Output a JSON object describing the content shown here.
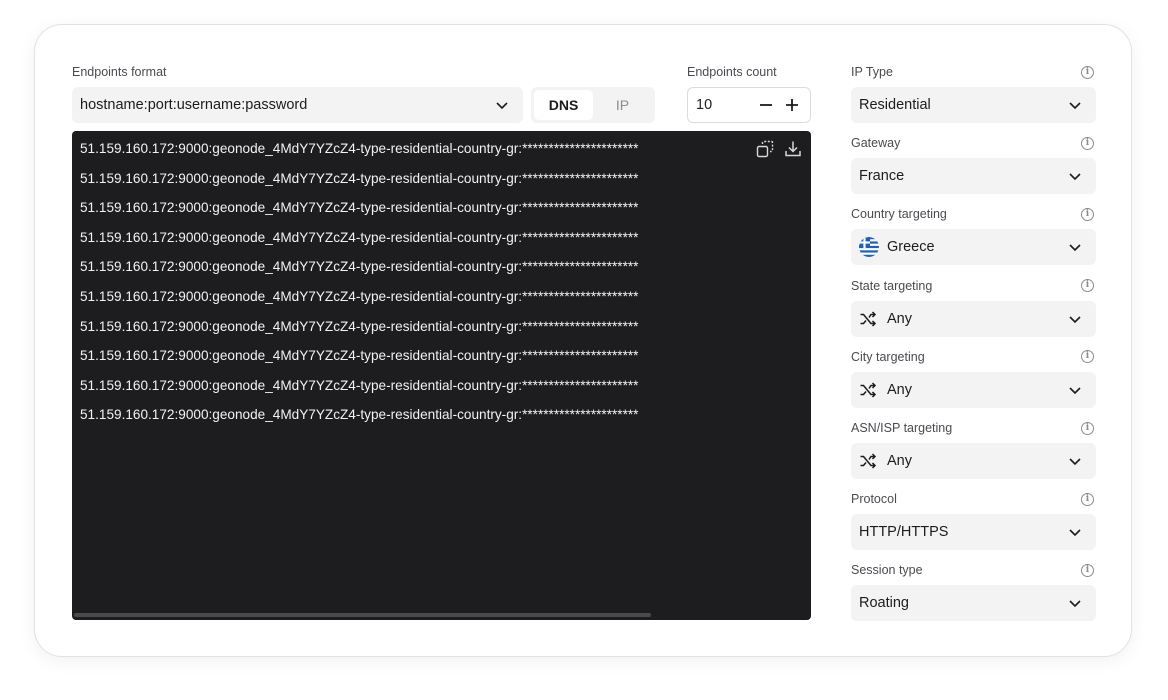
{
  "left": {
    "endpoints_format_label": "Endpoints format",
    "format_value": "hostname:port:username:password",
    "dns_toggle": [
      "DNS",
      "IP"
    ],
    "endpoints_count_label": "Endpoints count",
    "endpoints_count_value": "10",
    "endpoints": [
      "51.159.160.172:9000:geonode_4MdY7YZcZ4-type-residential-country-gr:**********************",
      "51.159.160.172:9000:geonode_4MdY7YZcZ4-type-residential-country-gr:**********************",
      "51.159.160.172:9000:geonode_4MdY7YZcZ4-type-residential-country-gr:**********************",
      "51.159.160.172:9000:geonode_4MdY7YZcZ4-type-residential-country-gr:**********************",
      "51.159.160.172:9000:geonode_4MdY7YZcZ4-type-residential-country-gr:**********************",
      "51.159.160.172:9000:geonode_4MdY7YZcZ4-type-residential-country-gr:**********************",
      "51.159.160.172:9000:geonode_4MdY7YZcZ4-type-residential-country-gr:**********************",
      "51.159.160.172:9000:geonode_4MdY7YZcZ4-type-residential-country-gr:**********************",
      "51.159.160.172:9000:geonode_4MdY7YZcZ4-type-residential-country-gr:**********************",
      "51.159.160.172:9000:geonode_4MdY7YZcZ4-type-residential-country-gr:**********************"
    ]
  },
  "right": {
    "ip_type": {
      "label": "IP Type",
      "value": "Residential"
    },
    "gateway": {
      "label": "Gateway",
      "value": "France"
    },
    "country": {
      "label": "Country targeting",
      "value": "Greece",
      "icon": "greece-flag-icon"
    },
    "state": {
      "label": "State targeting",
      "value": "Any",
      "icon": "shuffle-icon"
    },
    "city": {
      "label": "City targeting",
      "value": "Any",
      "icon": "shuffle-icon"
    },
    "asn": {
      "label": "ASN/ISP targeting",
      "value": "Any",
      "icon": "shuffle-icon"
    },
    "protocol": {
      "label": "Protocol",
      "value": "HTTP/HTTPS"
    },
    "session": {
      "label": "Session type",
      "value": "Roating"
    }
  },
  "colors": {
    "terminal_bg": "#1d1d1f",
    "field_bg": "#f3f3f4",
    "greece_blue": "#1f5fb8"
  }
}
